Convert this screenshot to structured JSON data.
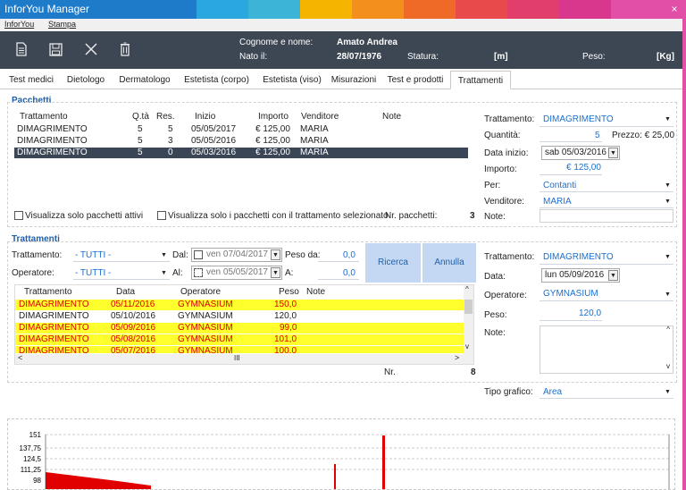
{
  "app": {
    "title": "InforYou Manager",
    "close_glyph": "×"
  },
  "menu": [
    "InforYou",
    "Stampa"
  ],
  "toolbar": {
    "icons": [
      "document-icon",
      "save-icon",
      "close-icon",
      "trash-icon"
    ],
    "cognome_label": "Cognome e nome:",
    "cognome_value": "Amato Andrea",
    "nato_label": "Nato il:",
    "nato_value": "28/07/1976",
    "statura_label": "Statura:",
    "statura_unit": "[m]",
    "peso_label": "Peso:",
    "peso_unit": "[Kg]"
  },
  "tabs": [
    "Test medici",
    "Dietologo",
    "Dermatologo",
    "Estetista (corpo)",
    "Estetista (viso)",
    "Misurazioni",
    "Test e prodotti",
    "Trattamenti"
  ],
  "active_tab": "Trattamenti",
  "pacchetti": {
    "title": "Pacchetti",
    "headers": [
      "Trattamento",
      "Q.tà",
      "Res.",
      "Inizio",
      "Importo",
      "Venditore",
      "Note"
    ],
    "rows": [
      [
        "DIMAGRIMENTO",
        "5",
        "5",
        "05/05/2017",
        "€ 125,00",
        "MARIA",
        ""
      ],
      [
        "DIMAGRIMENTO",
        "5",
        "3",
        "05/05/2016",
        "€ 125,00",
        "MARIA",
        ""
      ],
      [
        "DIMAGRIMENTO",
        "5",
        "0",
        "05/03/2016",
        "€ 125,00",
        "MARIA",
        ""
      ]
    ],
    "check_attivi": "Visualizza solo pacchetti attivi",
    "check_trattamento": "Visualizza solo i pacchetti con il trattamento selezionato",
    "nr_label": "Nr. pacchetti:",
    "nr_value": "3"
  },
  "pacchetto_detail": {
    "trattamento_label": "Trattamento:",
    "trattamento_value": "DIMAGRIMENTO",
    "quantita_label": "Quantità:",
    "quantita_value": "5",
    "prezzo_label": "Prezzo: € 25,00",
    "data_label": "Data inizio:",
    "data_value": "sab 05/03/2016",
    "importo_label": "Importo:",
    "importo_value": "€ 125,00",
    "per_label": "Per:",
    "per_value": "Contanti",
    "venditore_label": "Venditore:",
    "venditore_value": "MARIA",
    "note_label": "Note:"
  },
  "trattamenti": {
    "title": "Trattamenti",
    "filter_trattamento_label": "Trattamento:",
    "filter_trattamento_value": "- TUTTI -",
    "filter_operatore_label": "Operatore:",
    "filter_operatore_value": "- TUTTI -",
    "dal_label": "Dal:",
    "dal_value": "ven 07/04/2017",
    "al_label": "Al:",
    "al_value": "ven 05/05/2017",
    "peso_da_label": "Peso da:",
    "peso_da_value": "0,0",
    "a_label": "A:",
    "a_value": "0,0",
    "ricerca": "Ricerca",
    "annulla": "Annulla",
    "headers": [
      "Trattamento",
      "Data",
      "Operatore",
      "Peso",
      "Note"
    ],
    "rows": [
      [
        "DIMAGRIMENTO",
        "05/11/2016",
        "GYMNASIUM",
        "150,0",
        ""
      ],
      [
        "DIMAGRIMENTO",
        "05/10/2016",
        "GYMNASIUM",
        "120,0",
        ""
      ],
      [
        "DIMAGRIMENTO",
        "05/09/2016",
        "GYMNASIUM",
        "99,0",
        ""
      ],
      [
        "DIMAGRIMENTO",
        "05/08/2016",
        "GYMNASIUM",
        "101,0",
        ""
      ],
      [
        "DIMAGRIMENTO",
        "05/07/2016",
        "GYMNASIUM",
        "100,0",
        ""
      ]
    ],
    "scroll_mid": "III",
    "nr_label": "Nr.",
    "nr_value": "8"
  },
  "trattamento_detail": {
    "trattamento_label": "Trattamento:",
    "trattamento_value": "DIMAGRIMENTO",
    "data_label": "Data:",
    "data_value": "lun 05/09/2016",
    "operatore_label": "Operatore:",
    "operatore_value": "GYMNASIUM",
    "peso_label": "Peso:",
    "peso_value": "120,0",
    "note_label": "Note:",
    "tipo_label": "Tipo grafico:",
    "tipo_value": "Area"
  },
  "chart_data": {
    "type": "area",
    "y_ticks": [
      "151",
      "137,75",
      "124,5",
      "111,25",
      "98"
    ],
    "ylim": [
      98,
      151
    ],
    "series_color": "#e00000"
  }
}
